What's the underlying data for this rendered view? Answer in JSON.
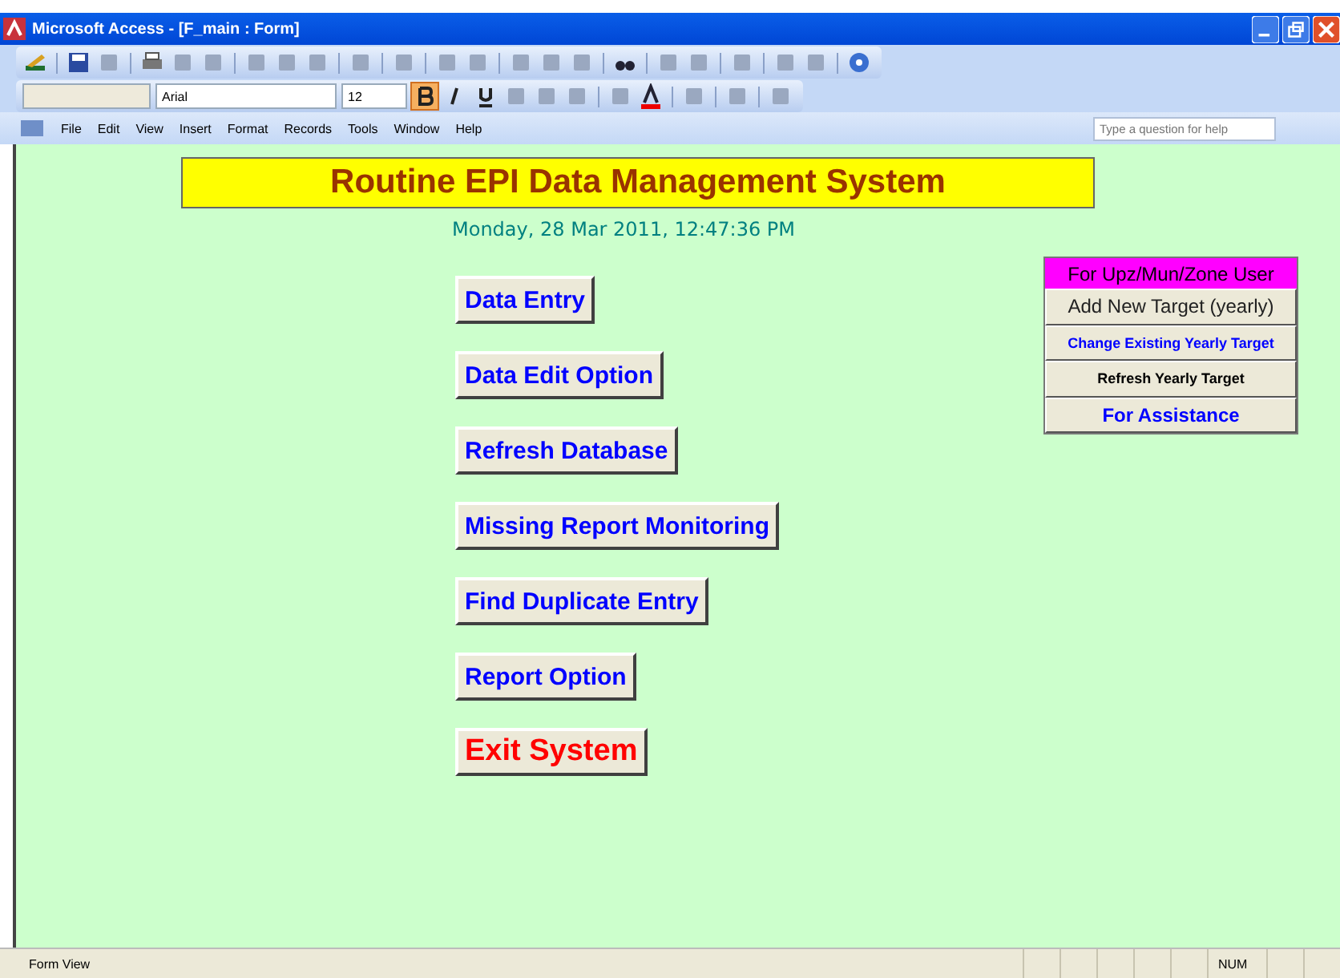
{
  "window": {
    "title": "Microsoft Access - [F_main : Form]"
  },
  "formatting_toolbar": {
    "font": "Arial",
    "size": "12",
    "bold": true
  },
  "menu": [
    "File",
    "Edit",
    "View",
    "Insert",
    "Format",
    "Records",
    "Tools",
    "Window",
    "Help"
  ],
  "help_box": {
    "placeholder": "Type a question for help"
  },
  "form": {
    "title": "Routine EPI Data Management System",
    "date": "Monday, 28 Mar 2011, 12:47:36 PM",
    "buttons": [
      {
        "label": "Data Entry",
        "kind": "normal"
      },
      {
        "label": "Data Edit Option",
        "kind": "normal"
      },
      {
        "label": "Refresh Database",
        "kind": "normal"
      },
      {
        "label": "Missing Report Monitoring",
        "kind": "normal"
      },
      {
        "label": "Find Duplicate Entry",
        "kind": "normal"
      },
      {
        "label": "Report Option",
        "kind": "normal"
      },
      {
        "label": "Exit System",
        "kind": "exit"
      }
    ],
    "panel": {
      "header": "For Upz/Mun/Zone User",
      "buttons": [
        {
          "label": "Add New Target (yearly)",
          "kind": "large"
        },
        {
          "label": "Change Existing Yearly Target",
          "kind": "blue-small"
        },
        {
          "label": "Refresh Yearly Target",
          "kind": "black-small"
        },
        {
          "label": "For Assistance",
          "kind": "blue"
        }
      ]
    }
  },
  "status_bar": {
    "mode": "Form View",
    "num": "NUM"
  }
}
